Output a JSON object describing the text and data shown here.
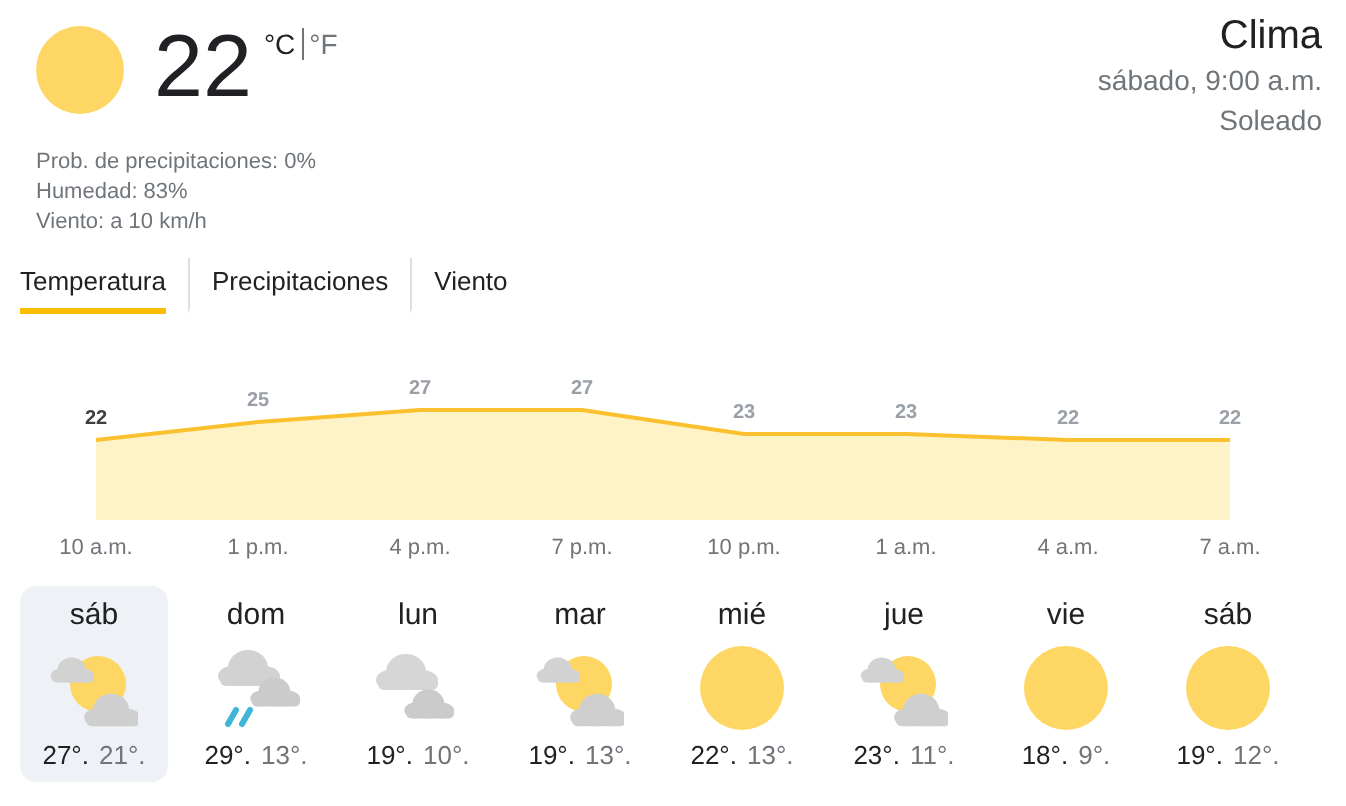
{
  "current": {
    "temperature": "22",
    "units": [
      {
        "label": "°C",
        "selected": true
      },
      {
        "label": "°F",
        "selected": false
      }
    ],
    "details": [
      "Prob. de precipitaciones: 0%",
      "Humedad: 83%",
      "Viento: a 10 km/h"
    ]
  },
  "header": {
    "title": "Clima",
    "datetime": "sábado, 9:00 a.m.",
    "condition": "Soleado"
  },
  "tabs": [
    {
      "label": "Temperatura",
      "selected": true
    },
    {
      "label": "Precipitaciones",
      "selected": false
    },
    {
      "label": "Viento",
      "selected": false
    }
  ],
  "chart": {
    "chart_data": {
      "type": "area",
      "categories": [
        "10 a.m.",
        "1 p.m.",
        "4 p.m.",
        "7 p.m.",
        "10 p.m.",
        "1 a.m.",
        "4 a.m.",
        "7 a.m."
      ],
      "series": [
        {
          "color": "#fbc02d",
          "values": [
            22,
            25,
            27,
            27,
            23,
            23,
            22,
            22
          ]
        }
      ],
      "data_labels": true
    }
  },
  "days": [
    {
      "day": "sáb",
      "kind": "partly-cloudy",
      "high": "27°.",
      "low": "21°.",
      "selected": true
    },
    {
      "day": "dom",
      "kind": "rain",
      "high": "29°.",
      "low": "13°.",
      "selected": false
    },
    {
      "day": "lun",
      "kind": "cloudy",
      "high": "19°.",
      "low": "10°.",
      "selected": false
    },
    {
      "day": "mar",
      "kind": "partly-cloudy",
      "high": "19°.",
      "low": "13°.",
      "selected": false
    },
    {
      "day": "mié",
      "kind": "sun",
      "high": "22°.",
      "low": "13°.",
      "selected": false
    },
    {
      "day": "jue",
      "kind": "partly-cloudy",
      "high": "23°.",
      "low": "11°.",
      "selected": false
    },
    {
      "day": "vie",
      "kind": "sun",
      "high": "18°.",
      "low": "9°.",
      "selected": false
    },
    {
      "day": "sáb",
      "kind": "sun",
      "high": "19°.",
      "low": "12°.",
      "selected": false
    }
  ]
}
